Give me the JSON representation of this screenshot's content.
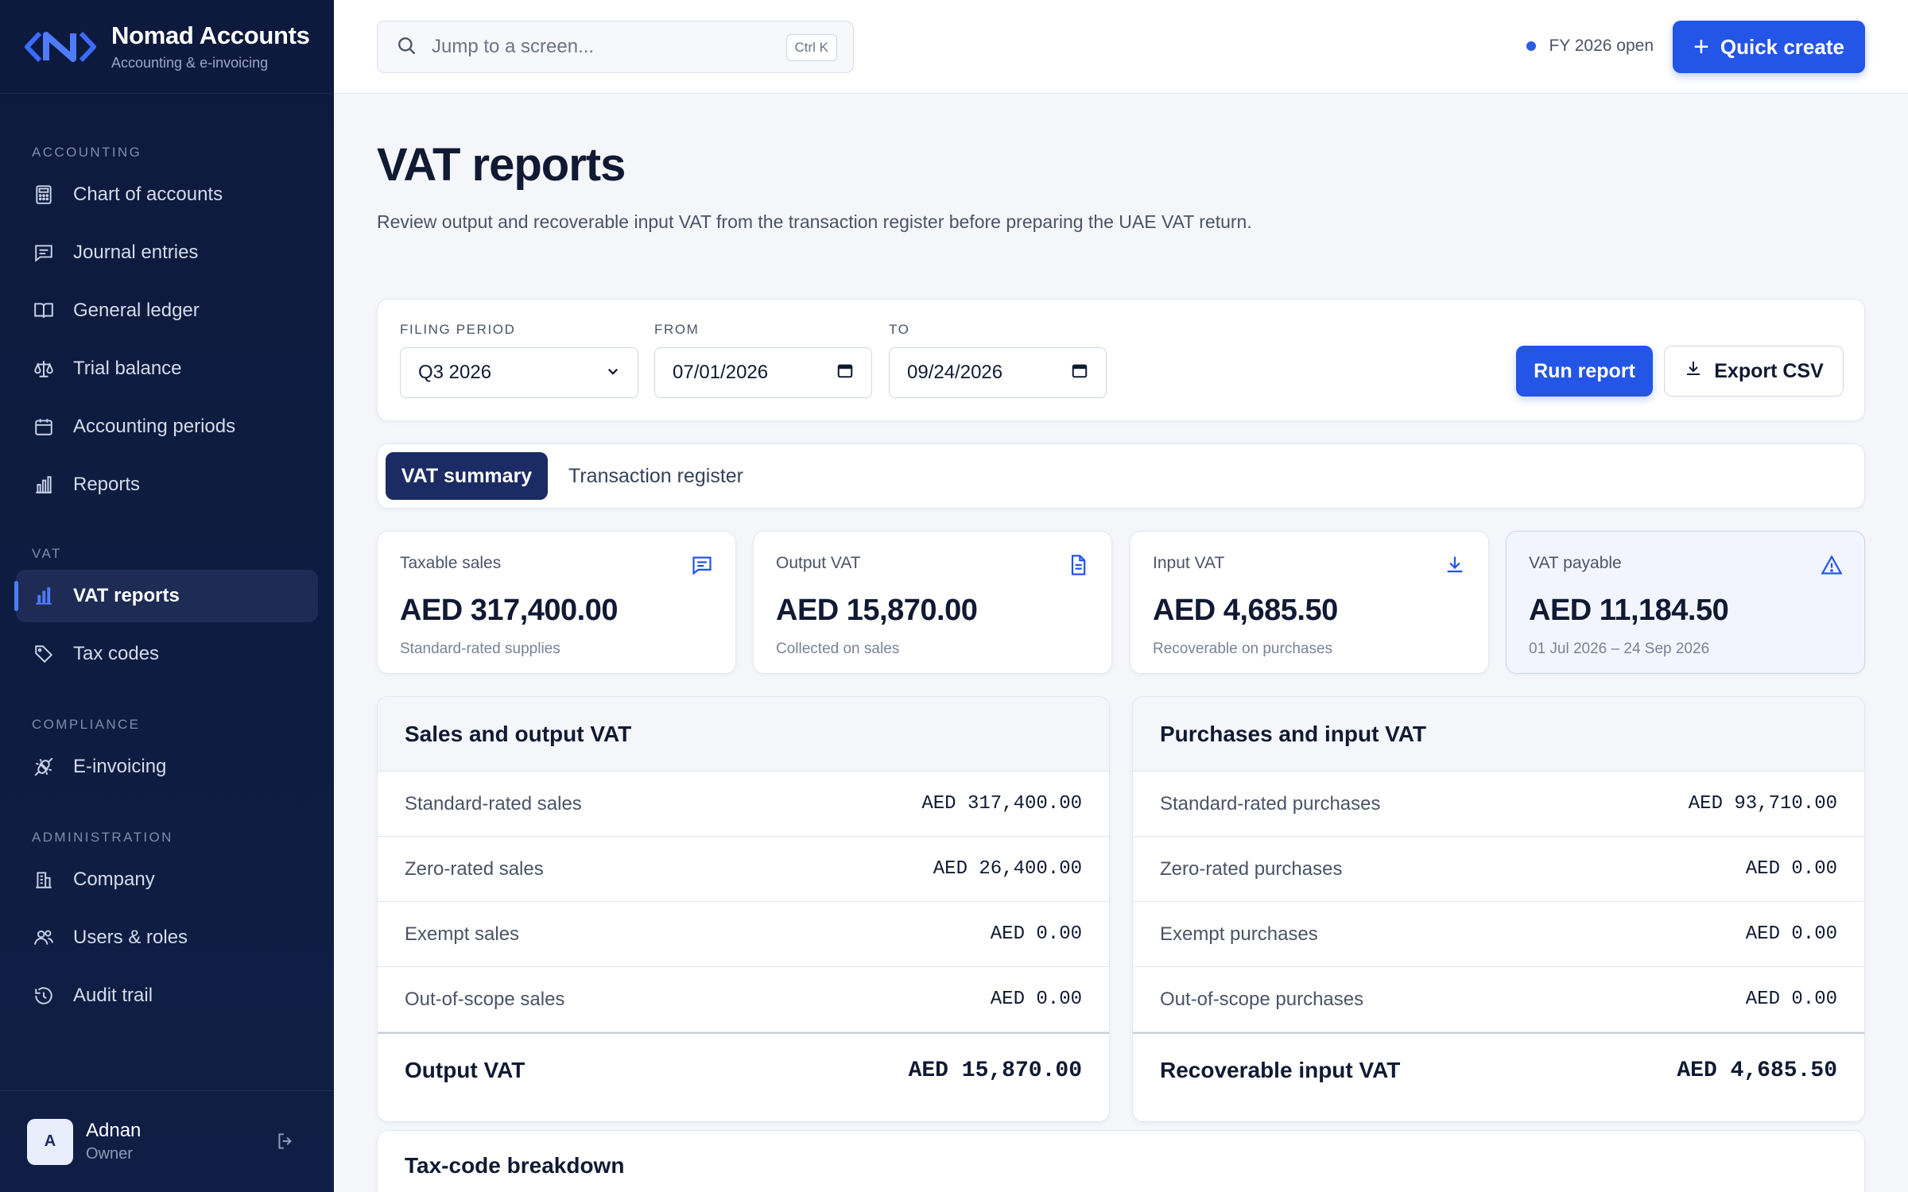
{
  "app": {
    "name": "Nomad Accounts",
    "subtitle": "Accounting & e-invoicing"
  },
  "sidebar": {
    "sections": [
      {
        "heading": "ACCOUNTING",
        "items": [
          {
            "label": "Chart of accounts",
            "icon": "calculator-icon"
          },
          {
            "label": "Journal entries",
            "icon": "journal-icon"
          },
          {
            "label": "General ledger",
            "icon": "book-icon"
          },
          {
            "label": "Trial balance",
            "icon": "scale-icon"
          },
          {
            "label": "Accounting periods",
            "icon": "calendar-icon"
          },
          {
            "label": "Reports",
            "icon": "bar-chart-icon"
          }
        ]
      },
      {
        "heading": "VAT",
        "items": [
          {
            "label": "VAT reports",
            "icon": "bar-chart-icon",
            "active": true
          },
          {
            "label": "Tax codes",
            "icon": "tag-icon"
          }
        ]
      },
      {
        "heading": "COMPLIANCE",
        "items": [
          {
            "label": "E-invoicing",
            "icon": "plug-icon"
          }
        ]
      },
      {
        "heading": "ADMINISTRATION",
        "items": [
          {
            "label": "Company",
            "icon": "building-icon"
          },
          {
            "label": "Users & roles",
            "icon": "users-icon"
          },
          {
            "label": "Audit trail",
            "icon": "history-icon"
          }
        ]
      }
    ],
    "user": {
      "initial": "A",
      "name": "Adnan",
      "role": "Owner"
    }
  },
  "topbar": {
    "search_placeholder": "Jump to a screen...",
    "shortcut": "Ctrl K",
    "fy_status": "FY 2026 open",
    "quick_create_label": "Quick create"
  },
  "page": {
    "title": "VAT reports",
    "description": "Review output and recoverable input VAT from the transaction register before preparing the UAE VAT return."
  },
  "filters": {
    "period_label": "FILING PERIOD",
    "period_value": "Q3 2026",
    "from_label": "FROM",
    "from_value": "07/01/2026",
    "to_label": "TO",
    "to_value": "09/24/2026",
    "run_label": "Run report",
    "export_label": "Export CSV"
  },
  "tabs": {
    "summary": "VAT summary",
    "register": "Transaction register"
  },
  "kpis": [
    {
      "label": "Taxable sales",
      "value": "AED 317,400.00",
      "sub": "Standard-rated supplies",
      "icon": "receipt-icon"
    },
    {
      "label": "Output VAT",
      "value": "AED 15,870.00",
      "sub": "Collected on sales",
      "icon": "document-icon"
    },
    {
      "label": "Input VAT",
      "value": "AED 4,685.50",
      "sub": "Recoverable on purchases",
      "icon": "download-icon"
    },
    {
      "label": "VAT payable",
      "value": "AED 11,184.50",
      "sub": "01 Jul 2026 – 24 Sep 2026",
      "icon": "warning-icon"
    }
  ],
  "sales_panel": {
    "title": "Sales and output VAT",
    "rows": [
      {
        "label": "Standard-rated sales",
        "value": "AED 317,400.00"
      },
      {
        "label": "Zero-rated sales",
        "value": "AED 26,400.00"
      },
      {
        "label": "Exempt sales",
        "value": "AED 0.00"
      },
      {
        "label": "Out-of-scope sales",
        "value": "AED 0.00"
      }
    ],
    "total_label": "Output VAT",
    "total_value": "AED 15,870.00"
  },
  "purchases_panel": {
    "title": "Purchases and input VAT",
    "rows": [
      {
        "label": "Standard-rated purchases",
        "value": "AED 93,710.00"
      },
      {
        "label": "Zero-rated purchases",
        "value": "AED 0.00"
      },
      {
        "label": "Exempt purchases",
        "value": "AED 0.00"
      },
      {
        "label": "Out-of-scope purchases",
        "value": "AED 0.00"
      }
    ],
    "total_label": "Recoverable input VAT",
    "total_value": "AED 4,685.50"
  },
  "breakdown": {
    "title": "Tax-code breakdown"
  },
  "colors": {
    "accent": "#2355e6",
    "sidebar": "#0d1a3d",
    "active_tab": "#1b2b63"
  }
}
